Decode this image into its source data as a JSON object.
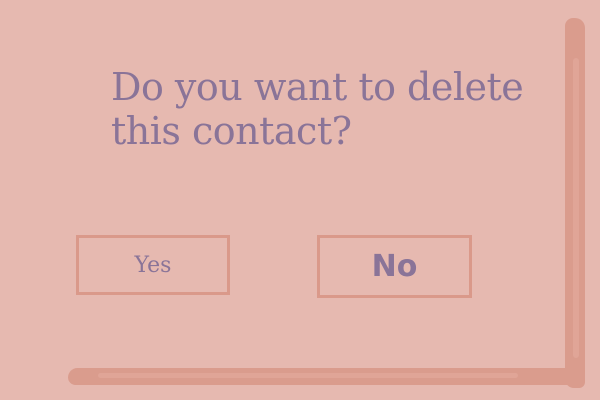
{
  "dialog": {
    "message": "Do you want to delete this contact?",
    "yes_label": "Yes",
    "no_label": "No"
  },
  "colors": {
    "background": "#e6b9b0",
    "text": "#8a7498",
    "border": "#da998a",
    "shadow": "#da9c8d"
  }
}
